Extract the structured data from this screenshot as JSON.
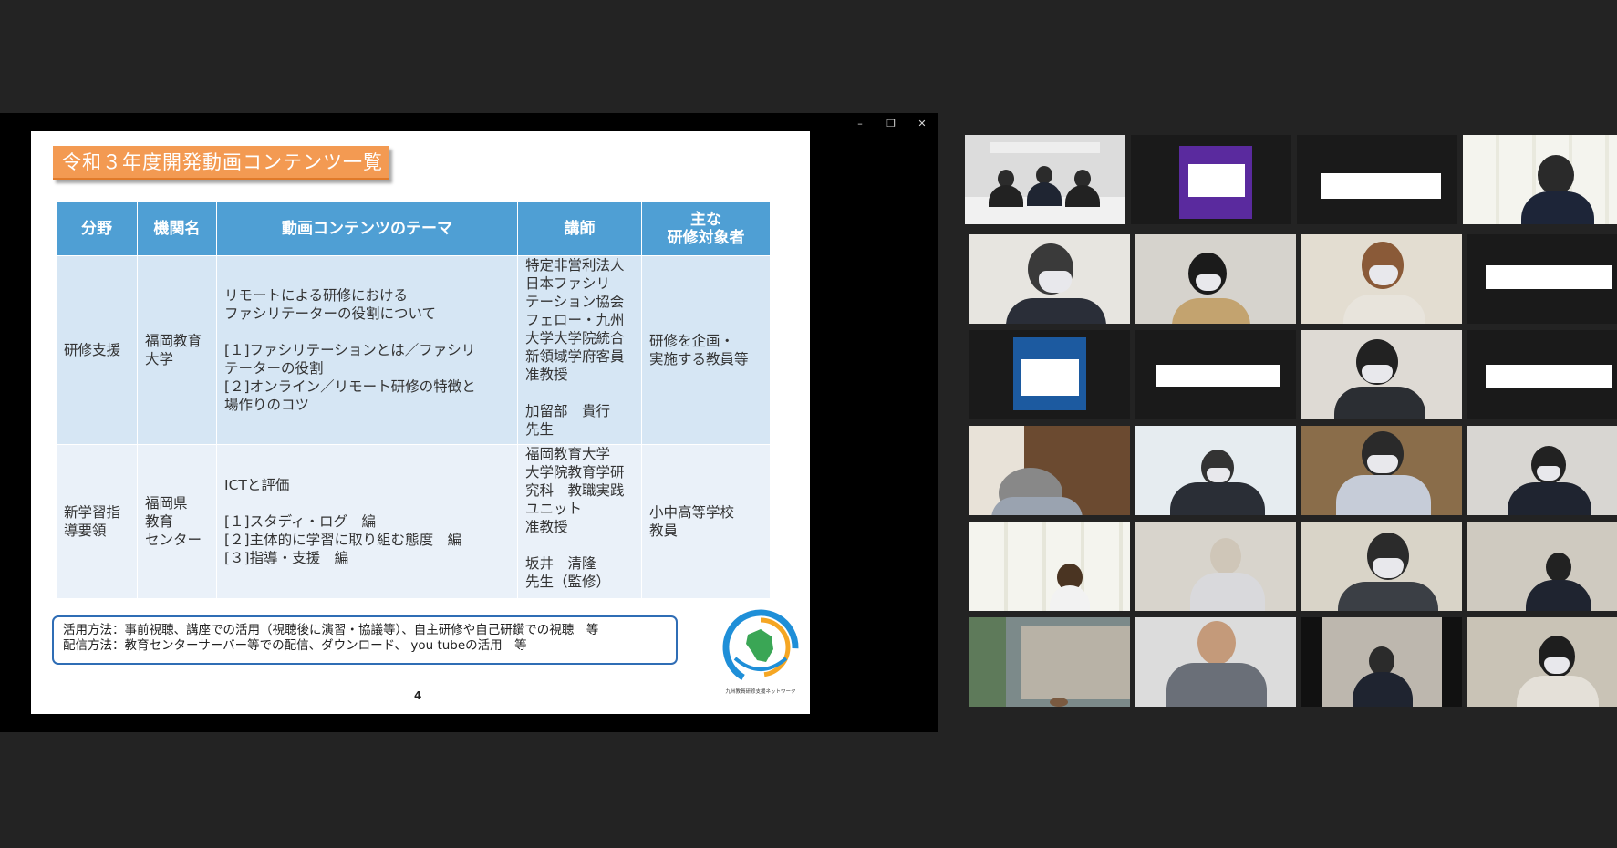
{
  "window": {
    "controls": [
      "–",
      "❐",
      "✕"
    ]
  },
  "slide": {
    "title": "令和３年度開発動画コンテンツ一覧",
    "headers": [
      "分野",
      "機関名",
      "動画コンテンツのテーマ",
      "講師",
      "主な\n研修対象者"
    ],
    "rows": [
      {
        "field": "研修支援",
        "institution": "福岡教育\n大学",
        "theme": "リモートによる研修における\nファシリテーターの役割について\n\n[１]ファシリテーションとは／ファシリ\nテーターの役割\n[２]オンライン／リモート研修の特徴と\n場作りのコツ",
        "lecturer": "特定非営利法人\n日本ファシリ\nテーション協会\nフェロー・九州\n大学大学院統合\n新領域学府客員\n准教授\n\n加留部　貴行\n先生",
        "target": "研修を企画・\n実施する教員等"
      },
      {
        "field": "新学習指\n導要領",
        "institution": "福岡県\n教育\nセンター",
        "theme": "ICTと評価\n\n[１]スタディ・ログ　編\n[２]主体的に学習に取り組む態度　編\n[３]指導・支援　編",
        "lecturer": "福岡教育大学\n大学院教育学研\n究科　教職実践\nユニット\n准教授\n\n坂井　清隆\n先生（監修）",
        "target": "小中高等学校\n教員"
      }
    ],
    "note_line1": "活用方法：事前視聴、講座での活用（視聴後に演習・協議等）、自主研修や自己研鑽での視聴　等",
    "note_line2": "配信方法：教育センターサーバー等での配信、ダウンロード、 you tubeの活用　等",
    "page_number": "4",
    "logo_caption": "九州教員研修支援ネットワーク"
  },
  "gallery": {
    "tiles": [
      {
        "id": "t1",
        "kind": "video",
        "active": true
      },
      {
        "id": "t2",
        "kind": "avatar",
        "color": "#5a2a9e"
      },
      {
        "id": "t3",
        "kind": "namecard"
      },
      {
        "id": "t4",
        "kind": "video"
      },
      {
        "id": "t5",
        "kind": "video"
      },
      {
        "id": "t6",
        "kind": "video"
      },
      {
        "id": "t7",
        "kind": "video"
      },
      {
        "id": "t8",
        "kind": "namecard"
      },
      {
        "id": "t9",
        "kind": "avatar",
        "color": "#1c5aa0"
      },
      {
        "id": "t10",
        "kind": "namecard"
      },
      {
        "id": "t11",
        "kind": "video"
      },
      {
        "id": "t12",
        "kind": "namecard"
      }
    ]
  },
  "colors": {
    "background": "#232323",
    "slide_title": "#f39a52",
    "table_header": "#4f9fd4",
    "row1": "#d6e6f4",
    "row2": "#eaf1f9",
    "active_speaker": "#cde63f"
  }
}
